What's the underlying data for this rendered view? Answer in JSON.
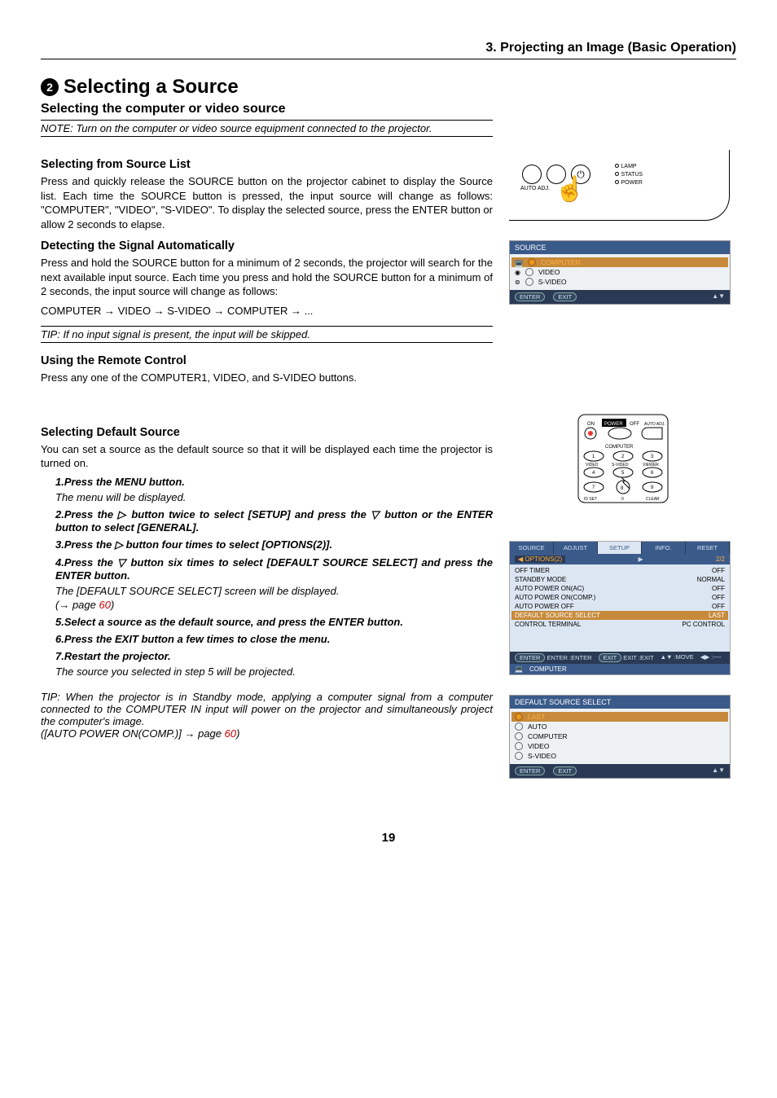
{
  "header": {
    "chapter": "3. Projecting an Image (Basic Operation)"
  },
  "section": {
    "number": "2",
    "title": "Selecting a Source",
    "subtitle": "Selecting the computer or video source",
    "note": "NOTE: Turn on the computer or video source equipment connected to the projector."
  },
  "blocks": {
    "source_list": {
      "heading": "Selecting from Source List",
      "text": "Press and quickly release the SOURCE button on the projector cabinet to display the Source list. Each time the SOURCE button is pressed, the input source will change as follows: \"COMPUTER\",  \"VIDEO\", \"S-VIDEO\". To display the selected source, press the ENTER button or allow 2 seconds to elapse."
    },
    "detect": {
      "heading": "Detecting the Signal Automatically",
      "text": "Press and hold the SOURCE button for a minimum of 2 seconds, the projector will search for the next available input source. Each time you press and hold the SOURCE button for a minimum of 2 seconds, the input source will change as follows:",
      "chain": "COMPUTER → VIDEO → S-VIDEO → COMPUTER → ...",
      "tip": "TIP: If no input signal is present, the input will be skipped."
    },
    "remote": {
      "heading": "Using the Remote Control",
      "text": "Press any one of the COMPUTER1, VIDEO, and S-VIDEO buttons."
    },
    "default": {
      "heading": "Selecting Default Source",
      "text": "You can set a source as the default source so that it will be displayed each time the projector is turned on.",
      "steps": [
        {
          "n": "1.",
          "b": "Press the MENU button.",
          "i": "The menu will be displayed."
        },
        {
          "n": "2.",
          "b_html": "Press the ▷ button twice to select [SETUP] and press the ▽ button or the ENTER button to select [GENERAL]."
        },
        {
          "n": "3.",
          "b_html": "Press the ▷ button four times to select [OPTIONS(2)]."
        },
        {
          "n": "4.",
          "b_html": "Press the ▽ button six times to select [DEFAULT SOURCE SELECT] and press the ENTER button.",
          "i": "The [DEFAULT SOURCE SELECT] screen will be displayed.",
          "ref_prefix": "(→ page ",
          "ref": "60",
          "ref_suffix": ")"
        },
        {
          "n": "5.",
          "b": "Select a source as the default source, and press the ENTER button."
        },
        {
          "n": "6.",
          "b": "Press the EXIT button a few times to close the menu."
        },
        {
          "n": "7.",
          "b": "Restart the projector.",
          "i": "The source you selected in step 5 will be projected."
        }
      ],
      "tip": "TIP: When the projector is in Standby mode, applying a computer signal from a computer connected to the COMPUTER IN input will power on the projector and simultaneously project the computer's image.",
      "tip_ref_prefix": "([AUTO POWER ON(COMP.)] → page ",
      "tip_ref": "60",
      "tip_ref_suffix": ")"
    }
  },
  "right": {
    "topbox": {
      "labels": [
        "LAMP",
        "STATUS",
        "POWER"
      ],
      "button_label": "AUTO ADJ."
    },
    "source_osd": {
      "title": "SOURCE",
      "items": [
        "COMPUTER",
        "VIDEO",
        "S-VIDEO"
      ],
      "selected": 0,
      "footer": {
        "enter": "ENTER",
        "exit": "EXIT"
      }
    },
    "remote_labels": {
      "row0": [
        "ON",
        "POWER",
        "OFF",
        "AUTO ADJ."
      ],
      "row1": [
        "COMPUTER"
      ],
      "row2": [
        "1",
        "2",
        "3"
      ],
      "row3": [
        "VIDEO",
        "S-VIDEO",
        "VIEWER"
      ],
      "row4": [
        "4",
        "5",
        "6"
      ],
      "row5": [
        "7",
        "8",
        "9"
      ],
      "row6": [
        "ID SET",
        "0",
        "CLEAR"
      ]
    },
    "setup_osd": {
      "tabs": [
        "SOURCE",
        "ADJUST",
        "SETUP",
        "INFO.",
        "RESET"
      ],
      "active_tab": "SETUP",
      "subtab_left": "◀ OPTIONS(2)",
      "subtab_right": "2/2",
      "rows": [
        {
          "k": "OFF TIMER",
          "v": "OFF"
        },
        {
          "k": "STANDBY MODE",
          "v": "NORMAL"
        },
        {
          "k": "AUTO POWER ON(AC)",
          "v": "OFF"
        },
        {
          "k": "AUTO POWER ON(COMP.)",
          "v": "OFF"
        },
        {
          "k": "AUTO POWER OFF",
          "v": "OFF"
        },
        {
          "k": "DEFAULT SOURCE SELECT",
          "v": "LAST",
          "hl": true
        },
        {
          "k": "CONTROL TERMINAL",
          "v": "PC CONTROL"
        }
      ],
      "footer1": [
        "ENTER  :ENTER",
        "EXIT  :EXIT",
        "▲▼ :MOVE",
        "◀▶ :----"
      ],
      "footer2_icon": "□",
      "footer2": "COMPUTER"
    },
    "default_src_osd": {
      "title": "DEFAULT SOURCE SELECT",
      "options": [
        "LAST",
        "AUTO",
        "COMPUTER",
        "VIDEO",
        "S-VIDEO"
      ],
      "selected": 0,
      "footer": {
        "enter": "ENTER",
        "exit": "EXIT"
      }
    }
  },
  "footer": {
    "pagenum": "19"
  }
}
